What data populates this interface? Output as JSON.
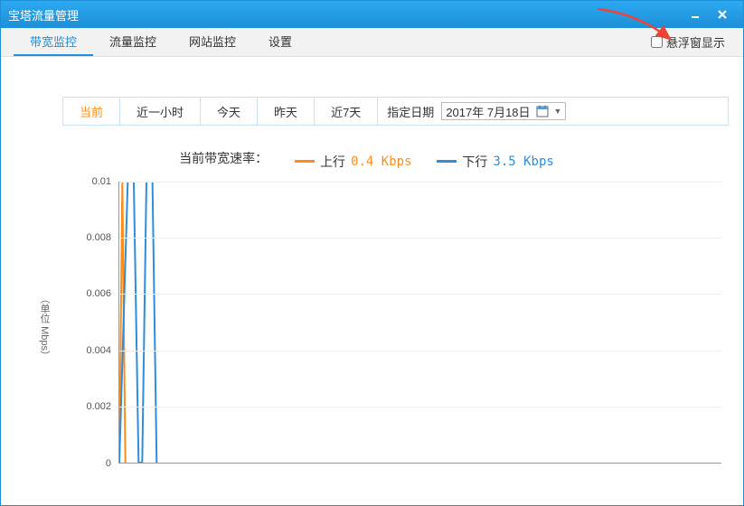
{
  "window": {
    "title": "宝塔流量管理"
  },
  "tabs": [
    {
      "label": "带宽监控",
      "active": true
    },
    {
      "label": "流量监控",
      "active": false
    },
    {
      "label": "网站监控",
      "active": false
    },
    {
      "label": "设置",
      "active": false
    }
  ],
  "float_window": {
    "label": "悬浮窗显示",
    "checked": false
  },
  "filters": {
    "buttons": [
      {
        "label": "当前",
        "active": true
      },
      {
        "label": "近一小时",
        "active": false
      },
      {
        "label": "今天",
        "active": false
      },
      {
        "label": "昨天",
        "active": false
      },
      {
        "label": "近7天",
        "active": false
      }
    ],
    "date_label": "指定日期",
    "date_value": "2017年 7月18日"
  },
  "legend": {
    "title": "当前带宽速率：",
    "up_label": "上行",
    "up_value": "0.4 Kbps",
    "down_label": "下行",
    "down_value": "3.5 Kbps"
  },
  "chart_data": {
    "type": "line",
    "ylabel": "（单位 Mbps）",
    "ylim": [
      0,
      0.01
    ],
    "y_ticks": [
      0,
      0.002,
      0.004,
      0.006,
      0.008,
      0.01
    ],
    "x_range": [
      0,
      100
    ],
    "series": [
      {
        "name": "上行",
        "color": "#ff8c1a",
        "points": [
          [
            0,
            0
          ],
          [
            0.5,
            0.01
          ],
          [
            1,
            0
          ]
        ]
      },
      {
        "name": "下行",
        "color": "#2f8ddb",
        "points": [
          [
            0,
            0
          ],
          [
            1.4,
            0.01
          ],
          [
            2.4,
            0.01
          ],
          [
            3.2,
            0
          ],
          [
            3.8,
            0
          ],
          [
            4.5,
            0.01
          ],
          [
            5.5,
            0.01
          ],
          [
            6.2,
            0
          ]
        ]
      }
    ]
  },
  "colors": {
    "accent": "#1d8fd8",
    "orange": "#ff8c1a",
    "blue": "#2f8ddb"
  }
}
